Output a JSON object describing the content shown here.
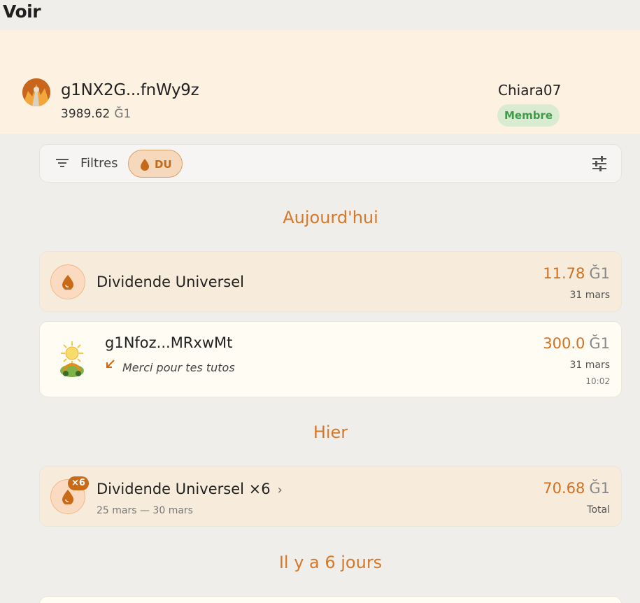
{
  "page": {
    "title": "Voir"
  },
  "header": {
    "address": "g1NX2G...fnWy9z",
    "balance": "3989.62",
    "currency": "Ğ1",
    "username": "Chiara07",
    "badge": "Membre"
  },
  "filters": {
    "label": "Filtres",
    "chip": "DU"
  },
  "sections": {
    "today": "Aujourd'hui",
    "yesterday": "Hier",
    "six_days": "Il y a 6 jours"
  },
  "items": {
    "du_today": {
      "title": "Dividende Universel",
      "amount": "11.78",
      "currency": "Ğ1",
      "date": "31 mars"
    },
    "tx_today": {
      "title": "g1Nfoz...MRxwMt",
      "comment": "Merci pour tes tutos",
      "amount": "300.0",
      "currency": "Ğ1",
      "date": "31 mars",
      "time": "10:02"
    },
    "du_group": {
      "title": "Dividende Universel ×6",
      "badge": "×6",
      "range": "25 mars — 30 mars",
      "amount": "70.68",
      "currency": "Ğ1",
      "total_label": "Total"
    }
  },
  "colors": {
    "accent": "#d6782a",
    "header_bg": "#fdf1e1",
    "member_green": "#3f9b48"
  }
}
